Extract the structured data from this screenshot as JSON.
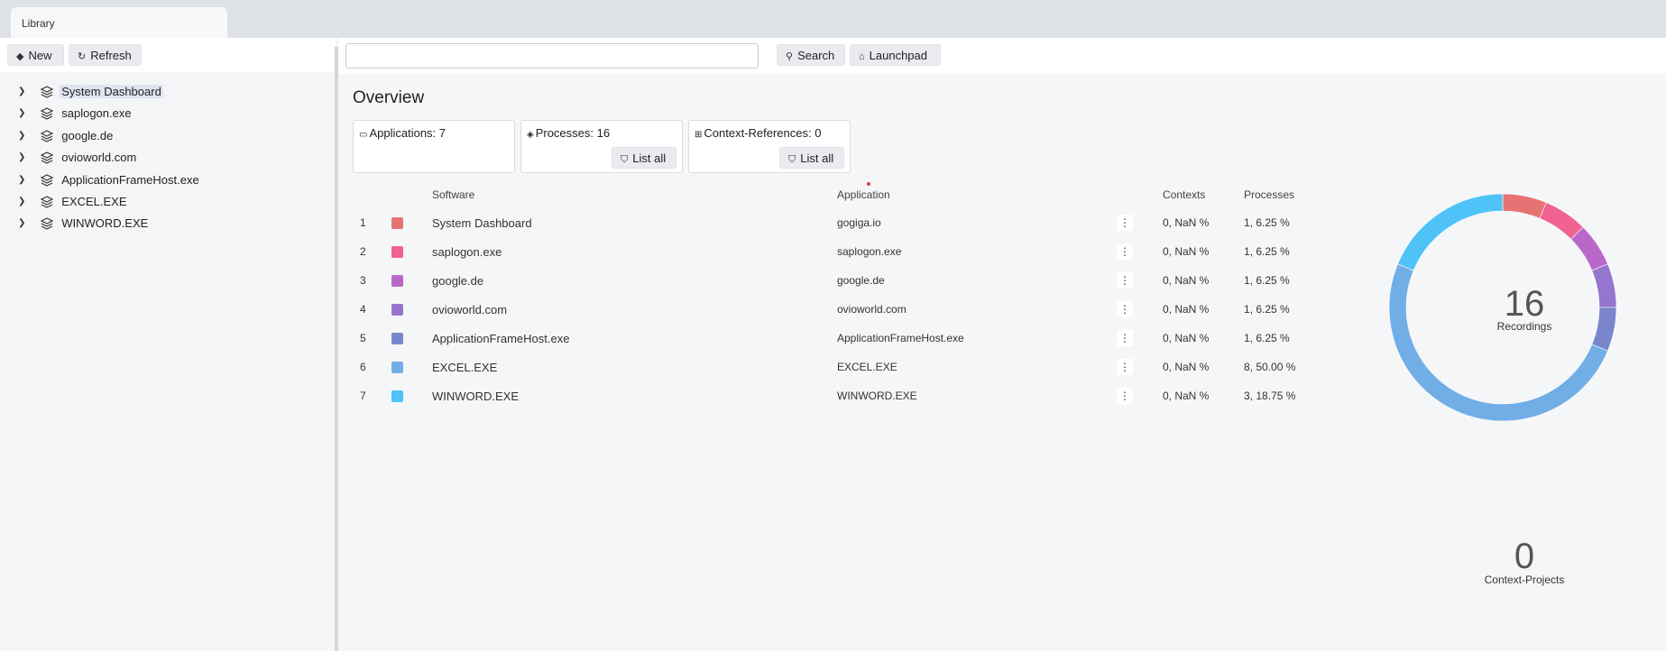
{
  "tab": {
    "label": "Library"
  },
  "sidebar": {
    "new_label": "New",
    "refresh_label": "Refresh",
    "items": [
      {
        "label": "System Dashboard",
        "selected": true
      },
      {
        "label": "saplogon.exe"
      },
      {
        "label": "google.de"
      },
      {
        "label": "ovioworld.com"
      },
      {
        "label": "ApplicationFrameHost.exe"
      },
      {
        "label": "EXCEL.EXE"
      },
      {
        "label": "WINWORD.EXE"
      }
    ]
  },
  "toolbar": {
    "search_value": "",
    "search_label": "Search",
    "launchpad_label": "Launchpad"
  },
  "overview": {
    "title": "Overview",
    "cards": {
      "applications": "Applications: 7",
      "processes": "Processes: 16",
      "context_refs": "Context-References: 0",
      "list_all": "List all"
    },
    "headers": {
      "software": "Software",
      "application": "Application",
      "contexts": "Contexts",
      "processes": "Processes"
    },
    "rows": [
      {
        "idx": "1",
        "color": "#e57373",
        "software": "System Dashboard",
        "application": "gogiga.io",
        "contexts": "0, NaN %",
        "processes": "1, 6.25 %",
        "menu": "⋮"
      },
      {
        "idx": "2",
        "color": "#f06292",
        "software": "saplogon.exe",
        "application": "saplogon.exe",
        "contexts": "0, NaN %",
        "processes": "1, 6.25 %",
        "menu": "⋮"
      },
      {
        "idx": "3",
        "color": "#ba68c8",
        "software": "google.de",
        "application": "google.de",
        "contexts": "0, NaN %",
        "processes": "1, 6.25 %",
        "menu": "⋮"
      },
      {
        "idx": "4",
        "color": "#9575cd",
        "software": "ovioworld.com",
        "application": "ovioworld.com",
        "contexts": "0, NaN %",
        "processes": "1, 6.25 %",
        "menu": "⋮"
      },
      {
        "idx": "5",
        "color": "#7986cb",
        "software": "ApplicationFrameHost.exe",
        "application": "ApplicationFrameHost.exe",
        "contexts": "0, NaN %",
        "processes": "1, 6.25 %",
        "menu": "⋮"
      },
      {
        "idx": "6",
        "color": "#72aee6",
        "software": "EXCEL.EXE",
        "application": "EXCEL.EXE",
        "contexts": "0, NaN %",
        "processes": "8, 50.00 %",
        "menu": "⋮"
      },
      {
        "idx": "7",
        "color": "#4fc3f7",
        "software": "WINWORD.EXE",
        "application": "WINWORD.EXE",
        "contexts": "0, NaN %",
        "processes": "3, 18.75 %",
        "menu": "⋮"
      }
    ],
    "recordings": {
      "count": "16",
      "label": "Recordings"
    },
    "context_projects": {
      "count": "0",
      "label": "Context-Projects"
    }
  },
  "chart_data": {
    "type": "pie",
    "categories": [
      "System Dashboard",
      "saplogon.exe",
      "google.de",
      "ovioworld.com",
      "ApplicationFrameHost.exe",
      "EXCEL.EXE",
      "WINWORD.EXE"
    ],
    "values": [
      1,
      1,
      1,
      1,
      1,
      8,
      3
    ],
    "colors": [
      "#e57373",
      "#f06292",
      "#ba68c8",
      "#9575cd",
      "#7986cb",
      "#72aee6",
      "#4fc3f7"
    ],
    "donut": true
  }
}
